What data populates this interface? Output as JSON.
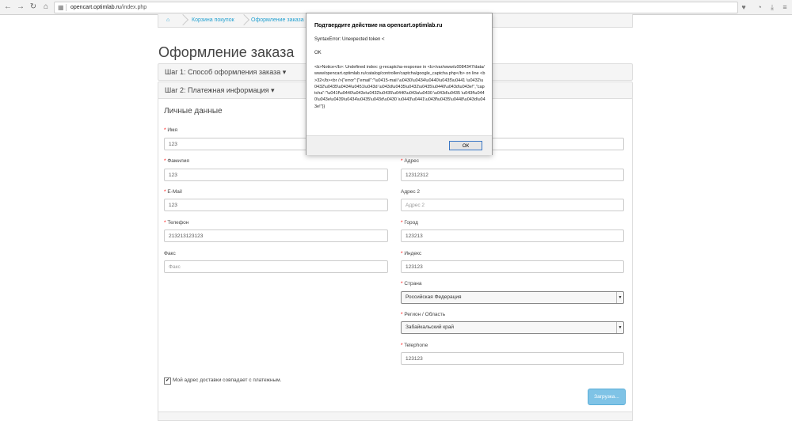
{
  "browser": {
    "url_host": "opencart.optimlab.ru",
    "url_path": "/index.php"
  },
  "breadcrumb": {
    "items": [
      "Корзина покупок",
      "Оформление заказа"
    ]
  },
  "page": {
    "title": "Оформление заказа",
    "step1": "Шаг 1: Способ оформления заказа ▾",
    "step2": "Шаг 2: Платежная информация ▾",
    "section_title": "Личные данные"
  },
  "form": {
    "firstname": {
      "label": "Имя",
      "value": "123"
    },
    "lastname": {
      "label": "Фамилия",
      "value": "123"
    },
    "email": {
      "label": "E-Mail",
      "value": "123"
    },
    "telephone": {
      "label": "Телефон",
      "value": "213213123123"
    },
    "fax": {
      "label": "Факс",
      "placeholder": "Факс"
    },
    "address1": {
      "label": "Адрес",
      "value": "12312312"
    },
    "address2": {
      "label": "Адрес 2",
      "placeholder": "Адрес 2"
    },
    "city": {
      "label": "Город",
      "value": "123213"
    },
    "postcode": {
      "label": "Индекс",
      "value": "123123"
    },
    "country": {
      "label": "Страна",
      "value": "Российская Федерация"
    },
    "zone": {
      "label": "Регион / Область",
      "value": "Забайкальский край"
    },
    "telephone2": {
      "label": "Telephone",
      "value": "123123"
    },
    "same_address": "Мой адрес доставки совпадает с платежным.",
    "load_button": "Загрузка..."
  },
  "dialog": {
    "title": "Подтвердите действие на opencart.optimlab.ru",
    "error": "SyntaxError: Unexpected token <",
    "ok_text": "OK",
    "body": "<b>Notice</b>: Undefined index: g-recaptcha-response in <b>/var/www/u0084347/data/www/opencart.optimlab.ru/catalog/controller/captcha/google_captcha.php</b> on line <b>32</b><br />{\"error\":{\"email\":\"\\u0415-mail \\u0430\\u0434\\u0440\\u0435\\u0441 \\u0432\\u0432\\u0435\\u0434\\u0451\\u043d \\u043d\\u0435\\u0432\\u0435\\u0440\\u043d\\u043e!\",\"captcha\":\"\\u041f\\u0440\\u043e\\u0432\\u0435\\u0440\\u043a\\u0430 \\u043d\\u0435 \\u043f\\u0440\\u043e\\u0439\\u0434\\u0435\\u043d\\u0430 \\u0443\\u0441\\u043f\\u0435\\u0448\\u043d\\u043e!\"}}",
    "button": "ОК"
  }
}
